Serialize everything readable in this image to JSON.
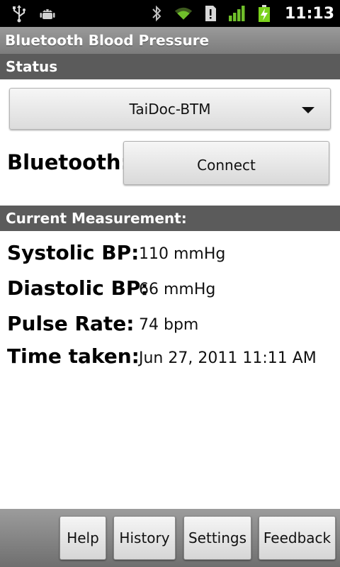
{
  "statusbar": {
    "time": "11:13",
    "icons_left": [
      "usb-icon",
      "android-debug-icon"
    ],
    "icons_right": [
      "bluetooth-icon",
      "wifi-icon",
      "sd-card-alert-icon",
      "signal-icon",
      "battery-charging-icon"
    ],
    "colors": {
      "wifi": "#6fbf2a",
      "signal": "#6fbf2a",
      "battery": "#7bd21c"
    }
  },
  "app": {
    "title": "Bluetooth Blood Pressure"
  },
  "status_section": {
    "header": "Status",
    "device_spinner": {
      "selected": "TaiDoc-BTM"
    },
    "bluetooth_label": "Bluetooth:",
    "connect_label": "Connect"
  },
  "measurement_section": {
    "header": "Current Measurement:",
    "rows": [
      {
        "label": "Systolic BP:",
        "value": "110 mmHg"
      },
      {
        "label": "Diastolic BP:",
        "value": "66 mmHg"
      },
      {
        "label": "Pulse Rate:",
        "value": "74 bpm"
      },
      {
        "label": "Time taken:",
        "value": "Jun 27, 2011 11:11 AM"
      }
    ]
  },
  "bottom_bar": {
    "help": "Help",
    "history": "History",
    "settings": "Settings",
    "feedback": "Feedback"
  }
}
